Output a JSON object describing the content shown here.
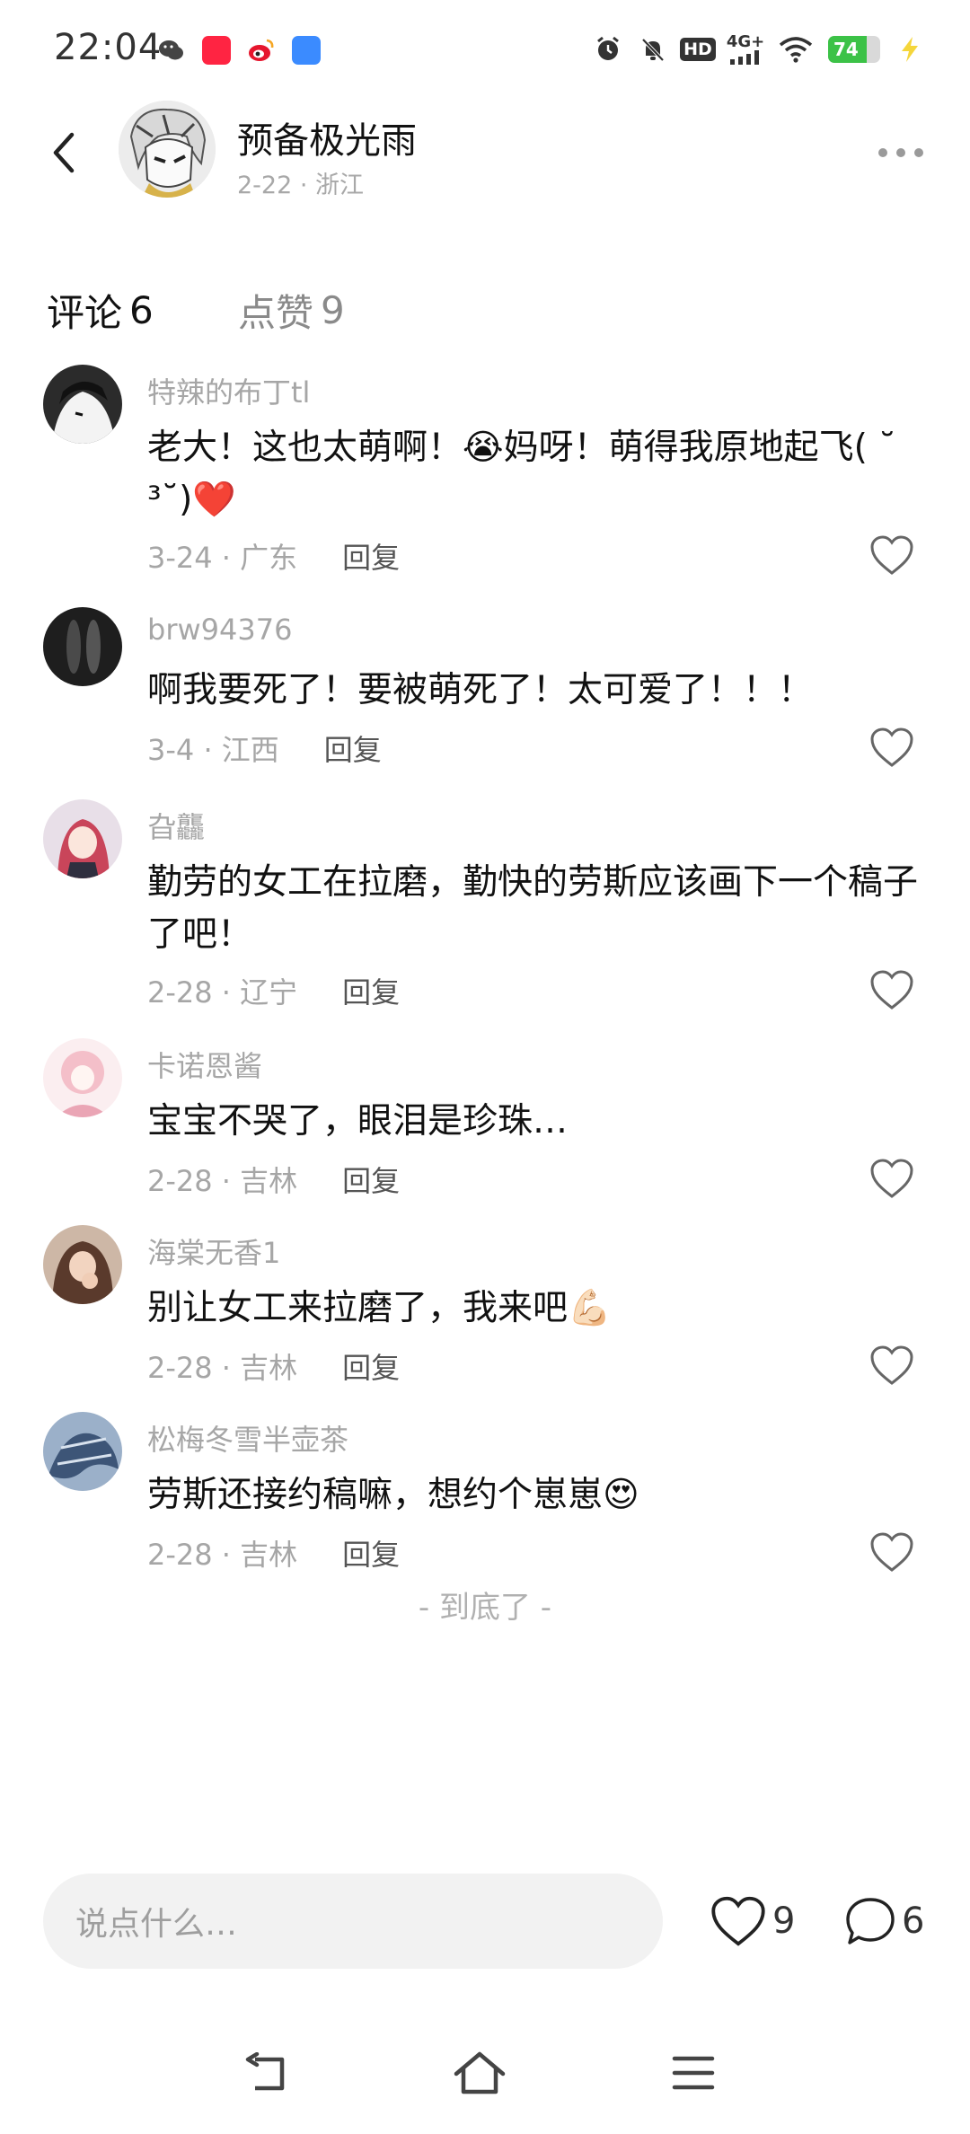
{
  "status_bar": {
    "time": "22:04",
    "network": "4G+",
    "hd": "HD",
    "battery": "74",
    "battery_level": 0.74,
    "left_icons": [
      "wechat-icon",
      "xiaohongshu-icon",
      "weibo-icon",
      "app-icon"
    ],
    "right_icons": [
      "alarm-icon",
      "mute-bell-icon",
      "hd-icon",
      "signal-icon",
      "wifi-icon",
      "battery-icon",
      "charging-icon"
    ]
  },
  "header": {
    "author_name": "预备极光雨",
    "author_meta": "2-22 · 浙江"
  },
  "tabs": {
    "comments_label": "评论",
    "comments_count": "6",
    "likes_label": "点赞",
    "likes_count": "9"
  },
  "comments": [
    {
      "user": "特辣的布丁tl",
      "text": "老大！这也太萌啊！😭妈呀！萌得我原地起飞( ˘ ³˘)❤️",
      "date": "3-24 · 广东",
      "reply": "回复",
      "avatar_color": "#2b2b2b"
    },
    {
      "user": "brw94376",
      "text": "啊我要死了！要被萌死了！太可爱了！！！",
      "date": "3-4 · 江西",
      "reply": "回复",
      "avatar_color": "#3a3a3a"
    },
    {
      "user": "旮龘",
      "text": "勤劳的女工在拉磨，勤快的劳斯应该画下一个稿子了吧！",
      "date": "2-28 · 辽宁",
      "reply": "回复",
      "avatar_color": "#c96a7a"
    },
    {
      "user": "卡诺恩酱",
      "text": "宝宝不哭了，眼泪是珍珠…",
      "date": "2-28 · 吉林",
      "reply": "回复",
      "avatar_color": "#f1c6cf"
    },
    {
      "user": "海棠无香1",
      "text": "别让女工来拉磨了，我来吧💪🏻",
      "date": "2-28 · 吉林",
      "reply": "回复",
      "avatar_color": "#6b4a3a"
    },
    {
      "user": "松梅冬雪半壶茶",
      "text": "劳斯还接约稿嘛，想约个崽崽😍",
      "date": "2-28 · 吉林",
      "reply": "回复",
      "avatar_color": "#4a6383"
    }
  ],
  "end_text": "- 到底了 -",
  "bottom_bar": {
    "input_placeholder": "说点什么…",
    "like_count": "9",
    "comment_count": "6"
  },
  "colors": {
    "accent_underline": "#c8ef6a",
    "battery_green": "#3cc247"
  }
}
